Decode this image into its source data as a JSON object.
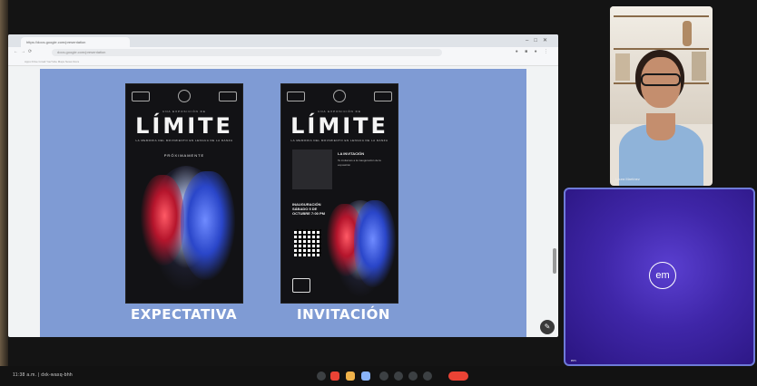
{
  "browser": {
    "tab_title": "https://docs.google.com/presentation",
    "url": "docs.google.com/presentation",
    "bookmarks": "Apps   Drive   Gmail   YouTube   Maps   News   Docs"
  },
  "slide": {
    "left_poster": {
      "kicker": "UNA EXPOSICIÓN DE",
      "title": "LÍMITE",
      "subtitle": "LA MEMORIA DEL MOVIMIENTO EN LENGUA DE LA DANZA",
      "date": "PRÓXIMAMENTE"
    },
    "right_poster": {
      "kicker": "UNA EXPOSICIÓN DE",
      "title": "LÍMITE",
      "subtitle": "LA MEMORIA DEL MOVIMIENTO EN LENGUA DE LA DANZA",
      "info_title": "LA INVITACIÓN",
      "info_text": "Te invitamos a la inauguración de la exposición",
      "cta": "INAUGURACIÓN SÁBADO 5 DE OCTUBRE 7:00 PM"
    },
    "caption_left": "EXPECTATIVA",
    "caption_right": "INVITACIÓN"
  },
  "participants": {
    "self_view_name": "Laura Martínez",
    "tile2_initials": "em",
    "tile2_name": "em"
  },
  "meeting": {
    "time": "11:38 a.m.",
    "separator": "|",
    "code": "dxk-wasq-bhh"
  },
  "controls": [
    "mic-icon",
    "camera-icon",
    "captions-icon",
    "present-icon",
    "emoji-icon",
    "hand-icon",
    "more-icon",
    "hangup-icon"
  ],
  "colors": {
    "slide_background": "#7f9bd4",
    "tile_purple": "#3f26a8",
    "hangup_red": "#ea4335",
    "active_control": "#8ab4f8"
  }
}
